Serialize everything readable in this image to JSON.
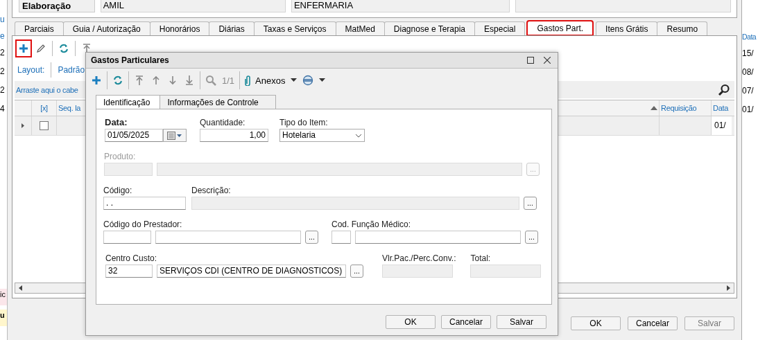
{
  "left_panel": {
    "top": [
      "u",
      "e"
    ],
    "rows": [
      "2",
      "2",
      "2",
      "4"
    ],
    "bottom": [
      "ic",
      "u"
    ]
  },
  "main": {
    "header": {
      "label": "Elaboração",
      "fields": [
        {
          "value": "AMIL",
          "disabled": true
        },
        {
          "value": "ENFERMARIA",
          "disabled": true
        },
        {
          "disabled": true
        }
      ]
    },
    "tabs": [
      {
        "label": "Parciais",
        "selected": false,
        "highlighted": false
      },
      {
        "label": "Guia / Autorização",
        "selected": false,
        "highlighted": false
      },
      {
        "label": "Honorários",
        "selected": false,
        "highlighted": false
      },
      {
        "label": "Diárias",
        "selected": false,
        "highlighted": false
      },
      {
        "label": "Taxas e Serviços",
        "selected": false,
        "highlighted": false
      },
      {
        "label": "MatMed",
        "selected": false,
        "highlighted": false
      },
      {
        "label": "Diagnose e Terapia",
        "selected": false,
        "highlighted": false
      },
      {
        "label": "Especial",
        "selected": false,
        "highlighted": false
      },
      {
        "label": "Gastos Part.",
        "selected": true,
        "highlighted": true
      },
      {
        "label": "Itens Grátis",
        "selected": false,
        "highlighted": false
      },
      {
        "label": "Resumo",
        "selected": false,
        "highlighted": false
      }
    ],
    "toolbar": [
      {
        "kind": "add",
        "highlighted": true
      },
      {
        "kind": "edit",
        "highlighted": false
      },
      {
        "kind": "separator"
      },
      {
        "kind": "refresh",
        "highlighted": false
      },
      {
        "kind": "separator"
      },
      {
        "kind": "first",
        "highlighted": false
      }
    ],
    "layout_bar": {
      "label": "Layout:",
      "value": "Padrão"
    },
    "group_panel": {
      "hint": "Arraste aqui o cabe"
    },
    "grid": {
      "columns": [
        {
          "label": "[x]",
          "sorted": false
        },
        {
          "label": "Seq. la",
          "sorted": false
        },
        {
          "sorted": true
        },
        {
          "label": "Requisição",
          "sorted": false
        },
        {
          "label": "Data",
          "sorted": false
        }
      ],
      "rows": [
        {
          "current": true,
          "checked": false,
          "date": "01/"
        }
      ]
    },
    "buttons": [
      {
        "label": "OK",
        "disabled": false
      },
      {
        "label": "Cancelar",
        "disabled": false
      },
      {
        "label": "Salvar",
        "disabled": true
      }
    ]
  },
  "right_panel": {
    "header": "Data",
    "rows": [
      "15/",
      "08/",
      "07/",
      "01/"
    ]
  },
  "dialog": {
    "title": "Gastos Particulares",
    "toolbar": [
      {
        "kind": "add",
        "disabled": false
      },
      {
        "kind": "separator"
      },
      {
        "kind": "refresh",
        "disabled": false
      },
      {
        "kind": "separator"
      },
      {
        "kind": "first",
        "disabled": false
      },
      {
        "kind": "up",
        "disabled": false
      },
      {
        "kind": "down",
        "disabled": false
      },
      {
        "kind": "last",
        "disabled": false
      },
      {
        "kind": "separator"
      },
      {
        "kind": "search",
        "disabled": false
      },
      {
        "kind": "counter",
        "text": "1/1",
        "disabled": true
      },
      {
        "kind": "separator"
      },
      {
        "kind": "attachments",
        "text": "Anexos",
        "disabled": false
      },
      {
        "kind": "view",
        "disabled": false
      }
    ],
    "tabs": [
      {
        "label": "Identificação",
        "selected": true
      },
      {
        "label": "Informações de Controle",
        "selected": false
      }
    ],
    "form": [
      {
        "groups": [
          {
            "label": "Data:",
            "required": true,
            "disabled": false,
            "kind": "date",
            "inputs": [
              {
                "value": "01/05/2025",
                "disabled": false
              }
            ]
          },
          {
            "label": "Quantidade:",
            "required": false,
            "disabled": false,
            "kind": "number",
            "inputs": [
              {
                "value": "1,00",
                "disabled": false
              }
            ]
          },
          {
            "label": "Tipo do Item:",
            "required": false,
            "disabled": false,
            "kind": "select",
            "inputs": [
              {
                "value": "Hotelaria",
                "disabled": false
              }
            ]
          }
        ]
      },
      {
        "groups": [
          {
            "label": "Produto:",
            "required": false,
            "disabled": true,
            "kind": "lookup",
            "button": "...",
            "inputs": [
              {
                "disabled": true
              },
              {
                "disabled": true
              }
            ]
          }
        ]
      },
      {
        "groups": [
          {
            "label": "Código:",
            "required": false,
            "disabled": false,
            "kind": "text",
            "inputs": [
              {
                "value": ". .",
                "disabled": false
              }
            ]
          },
          {
            "label": "Descrição:",
            "required": false,
            "disabled": false,
            "kind": "lookup",
            "button": "...",
            "inputs": [
              {
                "disabled": true
              }
            ]
          }
        ]
      },
      {
        "groups": [
          {
            "label": "Código do Prestador:",
            "required": false,
            "disabled": false,
            "kind": "lookup",
            "button": "...",
            "inputs": [
              {
                "disabled": false
              },
              {
                "disabled": false
              }
            ]
          },
          {
            "label": "Cod. Função Médico:",
            "required": false,
            "disabled": false,
            "kind": "lookup",
            "button": "...",
            "inputs": [
              {
                "disabled": false
              },
              {
                "disabled": false
              }
            ]
          }
        ]
      },
      {
        "groups": [
          {
            "label": "Centro Custo:",
            "required": false,
            "disabled": false,
            "kind": "lookup",
            "button": "...",
            "inputs": [
              {
                "value": "32",
                "disabled": false
              },
              {
                "value": "SERVIÇOS CDI (CENTRO DE DIAGNOSTICOS)",
                "disabled": false
              }
            ]
          },
          {
            "label": "Vlr.Pac./Perc.Conv.:",
            "required": false,
            "disabled": false,
            "kind": "text",
            "inputs": [
              {
                "disabled": true
              }
            ]
          },
          {
            "label": "Total:",
            "required": false,
            "disabled": false,
            "kind": "text",
            "inputs": [
              {
                "disabled": true
              }
            ]
          }
        ]
      }
    ],
    "buttons": [
      {
        "label": "OK",
        "disabled": false
      },
      {
        "label": "Cancelar",
        "disabled": false
      },
      {
        "label": "Salvar",
        "disabled": false
      }
    ]
  }
}
